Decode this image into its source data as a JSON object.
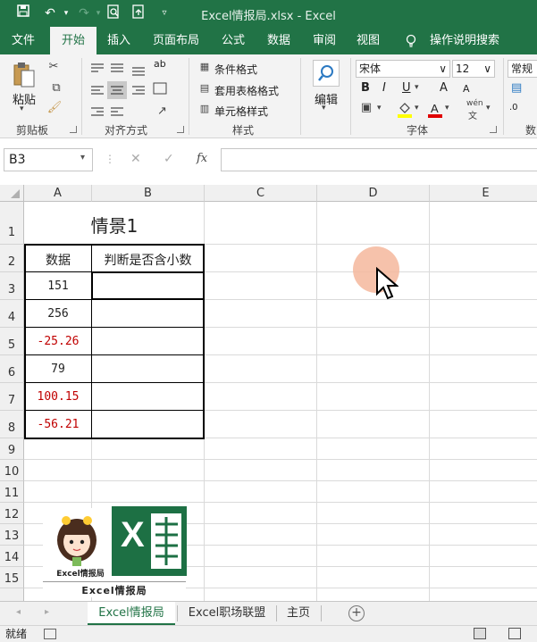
{
  "titlebar": {
    "title": "Excel情报局.xlsx  -  Excel",
    "accent": "#217346"
  },
  "tabs": [
    {
      "label": "文件"
    },
    {
      "label": "开始",
      "active": true
    },
    {
      "label": "插入"
    },
    {
      "label": "页面布局"
    },
    {
      "label": "公式"
    },
    {
      "label": "数据"
    },
    {
      "label": "审阅"
    },
    {
      "label": "视图"
    },
    {
      "label": "操作说明搜索"
    }
  ],
  "ribbon": {
    "clipboard": {
      "label": "剪贴板",
      "paste": "粘贴"
    },
    "alignment": {
      "label": "对齐方式"
    },
    "styles": {
      "label": "样式",
      "conditional": "条件格式",
      "table": "套用表格格式",
      "cell": "单元格样式"
    },
    "editing": {
      "label": "编辑"
    },
    "font": {
      "label": "字体",
      "name": "宋体",
      "size": "12",
      "bold": "B",
      "italic": "I",
      "underline": "U",
      "grow": "A",
      "shrink": "A",
      "wen": "wén",
      "wen2": "文"
    },
    "number": {
      "label": "数",
      "format": "常规"
    }
  },
  "formula_bar": {
    "name_box": "B3",
    "fx": "fx",
    "content": ""
  },
  "grid": {
    "columns": [
      "A",
      "B",
      "C",
      "D",
      "E"
    ],
    "rows": [
      "1",
      "2",
      "3",
      "4",
      "5",
      "6",
      "7",
      "8",
      "9",
      "10",
      "11",
      "12",
      "13",
      "14",
      "15"
    ],
    "title": "情景1",
    "header_a": "数据",
    "header_b": "判断是否含小数",
    "values": [
      "151",
      "256",
      "-25.26",
      "79",
      "100.15",
      "-56.21"
    ],
    "negative_color": "#c00000",
    "logo_caption": "Excel情报局",
    "logo_small": "Excel情报局",
    "logo_letter": "X"
  },
  "sheets": [
    {
      "label": "Excel情报局",
      "active": true
    },
    {
      "label": "Excel职场联盟"
    },
    {
      "label": "主页"
    }
  ],
  "status": {
    "ready": "就绪"
  }
}
